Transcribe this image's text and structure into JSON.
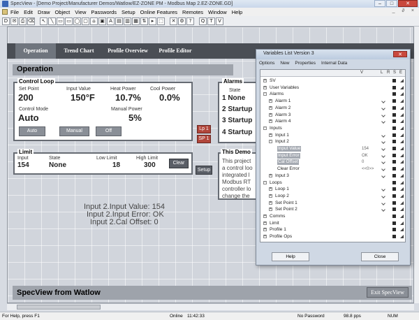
{
  "window": {
    "title": "SpecView - [Demo Project/Manufacturer Demos/Watlow/EZ-ZONE PM - Modbus Map 2.EZ-ZONE.GD]"
  },
  "menu": [
    "File",
    "Edit",
    "Draw",
    "Object",
    "View",
    "Passwords",
    "Setup",
    "Online Features",
    "Remotes",
    "Window",
    "Help"
  ],
  "menu_right": "_ ∂ ×",
  "toolbar_glyphs": [
    "D",
    "✉",
    "⎙",
    "⌫",
    "↖",
    "╲",
    "▭",
    "▭",
    "◯",
    "▢",
    "⌂",
    "▣",
    "A",
    "▤",
    "▥",
    "▦",
    "⇅",
    "▸",
    "⬚",
    "✕",
    "⚙",
    "?",
    "Q",
    "T",
    "V"
  ],
  "nav": {
    "tabs": [
      "Operation",
      "Trend Chart",
      "Profile Overview",
      "Profile Editor"
    ],
    "active": "Operation"
  },
  "operation": {
    "title": "Operation",
    "control_loop": {
      "title": "Control Loop",
      "set_point_label": "Set Point",
      "set_point": "200",
      "input_value_label": "Input Value",
      "input_value": "150°F",
      "heat_power_label": "Heat Power",
      "heat_power": "10.7%",
      "cool_power_label": "Cool Power",
      "cool_power": "0.0%",
      "control_mode_label": "Control Mode",
      "control_mode": "Auto",
      "manual_power_label": "Manual Power",
      "manual_power": "5%",
      "buttons": {
        "auto": "Auto",
        "manual": "Manual",
        "off": "Off"
      }
    },
    "side_buttons": {
      "lp1": "Lp 1",
      "sp1": "SP 1",
      "setup": "Setup"
    },
    "alarms": {
      "title": "Alarms",
      "state_label": "State",
      "rows": [
        "1 None",
        "2 Startup",
        "3 Startup",
        "4 Startup"
      ]
    },
    "limit": {
      "title": "Limit",
      "input_label": "Input",
      "input": "154",
      "state_label": "State",
      "state": "None",
      "low_limit_label": "Low Limit",
      "low_limit": "18",
      "high_limit_label": "High Limit",
      "high_limit": "300",
      "clear_label": "Clear"
    },
    "demo": {
      "title": "This Demo",
      "lines": [
        "This project",
        "a control loo",
        "integrated l",
        "Modbus RT",
        "controller lo",
        "change the"
      ]
    },
    "overlay_text": [
      "Input 2.Input Value: 154",
      "Input 2.Input Error: OK",
      "Input 2.Cal Offset: 0"
    ]
  },
  "footer": {
    "title": "SpecView from Watlow",
    "exit_label": "Exit SpecView"
  },
  "status": {
    "help": "For Help, press F1",
    "online": "Online",
    "time": "11:42:33",
    "password": "No Password",
    "pps": "98.8 pps",
    "num": "NUM"
  },
  "variables_window": {
    "title": "Variables List Version 3",
    "menu": [
      "Options",
      "New",
      "Properties",
      "Internal Data"
    ],
    "col_headers": [
      "V",
      "L",
      "R",
      "S",
      "E"
    ],
    "rows": [
      {
        "label": "SV",
        "indent": 0,
        "exp": "+",
        "value": ""
      },
      {
        "label": "User Variables",
        "indent": 0,
        "exp": "+",
        "value": ""
      },
      {
        "label": "Alarms",
        "indent": 0,
        "exp": "-",
        "value": ""
      },
      {
        "label": "Alarm 1",
        "indent": 1,
        "exp": "+",
        "value": ""
      },
      {
        "label": "Alarm 2",
        "indent": 1,
        "exp": "+",
        "value": ""
      },
      {
        "label": "Alarm 3",
        "indent": 1,
        "exp": "+",
        "value": ""
      },
      {
        "label": "Alarm 4",
        "indent": 1,
        "exp": "+",
        "value": ""
      },
      {
        "label": "Inputs",
        "indent": 0,
        "exp": "-",
        "value": ""
      },
      {
        "label": "Input 1",
        "indent": 1,
        "exp": "+",
        "value": ""
      },
      {
        "label": "Input 2",
        "indent": 1,
        "exp": "-",
        "value": ""
      },
      {
        "label": "Input Value",
        "indent": 2,
        "exp": "",
        "value": "154",
        "sel": true
      },
      {
        "label": "Input Error",
        "indent": 2,
        "exp": "",
        "value": "OK",
        "sel": true
      },
      {
        "label": "Cal Offset",
        "indent": 2,
        "exp": "",
        "value": "0",
        "sel": true
      },
      {
        "label": "Clear Error",
        "indent": 2,
        "exp": "",
        "value": "<<0>>"
      },
      {
        "label": "Input 3",
        "indent": 1,
        "exp": "+",
        "value": ""
      },
      {
        "label": "Loops",
        "indent": 0,
        "exp": "-",
        "value": ""
      },
      {
        "label": "Loop 1",
        "indent": 1,
        "exp": "+",
        "value": ""
      },
      {
        "label": "Loop 2",
        "indent": 1,
        "exp": "+",
        "value": ""
      },
      {
        "label": "Set Point 1",
        "indent": 1,
        "exp": "+",
        "value": ""
      },
      {
        "label": "Set Point 2",
        "indent": 1,
        "exp": "+",
        "value": ""
      },
      {
        "label": "Comms",
        "indent": 0,
        "exp": "+",
        "value": ""
      },
      {
        "label": "Limit",
        "indent": 0,
        "exp": "+",
        "value": ""
      },
      {
        "label": "Profile 1",
        "indent": 0,
        "exp": "+",
        "value": ""
      },
      {
        "label": "Profile Ops",
        "indent": 0,
        "exp": "+",
        "value": ""
      }
    ],
    "help_label": "Help",
    "close_label": "Close"
  }
}
